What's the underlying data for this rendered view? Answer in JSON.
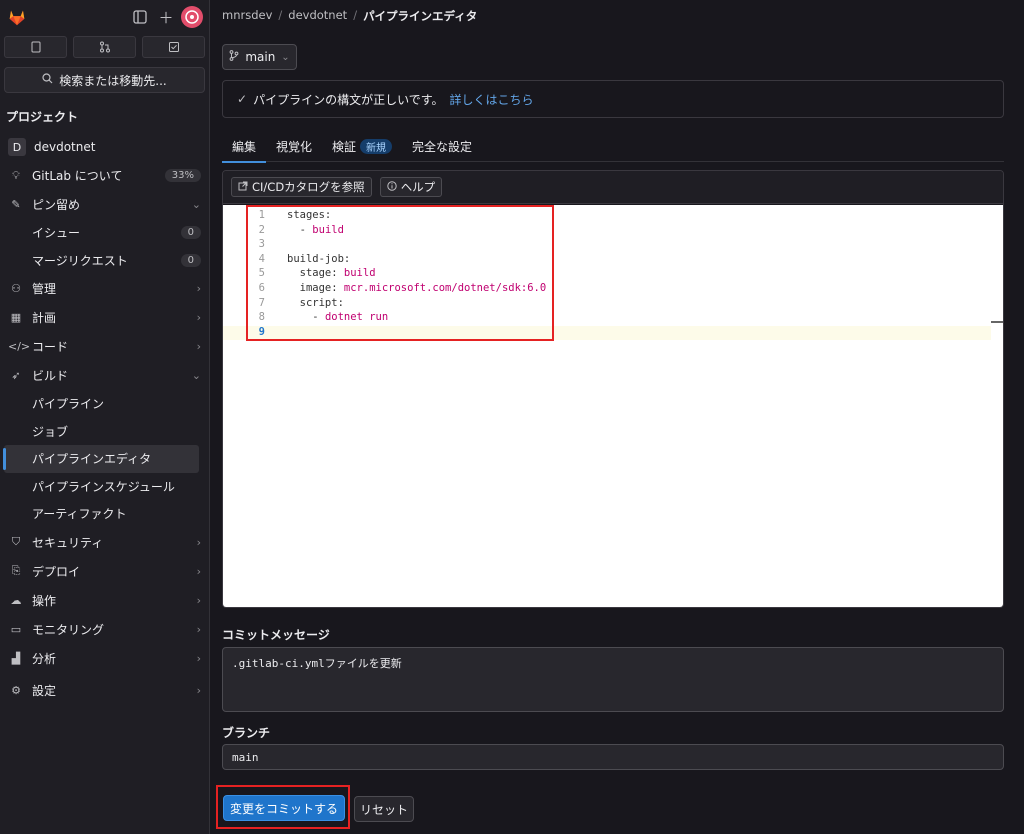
{
  "search": {
    "label": "検索または移動先..."
  },
  "sidebar": {
    "section_title": "プロジェクト",
    "project": {
      "badge": "D",
      "name": "devdotnet"
    },
    "about": {
      "label": "GitLab について",
      "badge": "33%"
    },
    "pinned": {
      "label": "ピン留め"
    },
    "issues": {
      "label": "イシュー",
      "count": "0"
    },
    "mrs": {
      "label": "マージリクエスト",
      "count": "0"
    },
    "manage": {
      "label": "管理"
    },
    "plan": {
      "label": "計画"
    },
    "code": {
      "label": "コード"
    },
    "build": {
      "label": "ビルド"
    },
    "build_sub": [
      "パイプライン",
      "ジョブ",
      "パイプラインエディタ",
      "パイプラインスケジュール",
      "アーティファクト"
    ],
    "security": {
      "label": "セキュリティ"
    },
    "deploy": {
      "label": "デプロイ"
    },
    "operate": {
      "label": "操作"
    },
    "monitor": {
      "label": "モニタリング"
    },
    "analyze": {
      "label": "分析"
    },
    "settings": {
      "label": "設定"
    }
  },
  "breadcrumb": [
    "mnrsdev",
    "devdotnet",
    "パイプラインエディタ"
  ],
  "branch_selector": {
    "label": "main"
  },
  "alert": {
    "text": "パイプラインの構文が正しいです。",
    "link": "詳しくはこちら"
  },
  "tabs": [
    {
      "label": "編集"
    },
    {
      "label": "視覚化"
    },
    {
      "label": "検証",
      "badge": "新規"
    },
    {
      "label": "完全な設定"
    }
  ],
  "toolbar": {
    "catalog_label": "CI/CDカタログを参照",
    "help_label": "ヘルプ"
  },
  "editor": {
    "lines": [
      {
        "no": "1",
        "key": "stages:",
        "val": ""
      },
      {
        "no": "2",
        "key": "  - ",
        "val": "build"
      },
      {
        "no": "3",
        "key": "",
        "val": ""
      },
      {
        "no": "4",
        "key": "build-job:",
        "val": ""
      },
      {
        "no": "5",
        "key": "  stage: ",
        "val": "build"
      },
      {
        "no": "6",
        "key": "  image: ",
        "val": "mcr.microsoft.com/dotnet/sdk:6.0"
      },
      {
        "no": "7",
        "key": "  script:",
        "val": ""
      },
      {
        "no": "8",
        "key": "    - ",
        "val": "dotnet run"
      },
      {
        "no": "9",
        "key": "",
        "val": ""
      }
    ]
  },
  "commit": {
    "message_label": "コミットメッセージ",
    "message_value": ".gitlab-ci.ymlファイルを更新",
    "branch_label": "ブランチ",
    "branch_value": "main",
    "commit_button": "変更をコミットする",
    "reset_button": "リセット"
  }
}
